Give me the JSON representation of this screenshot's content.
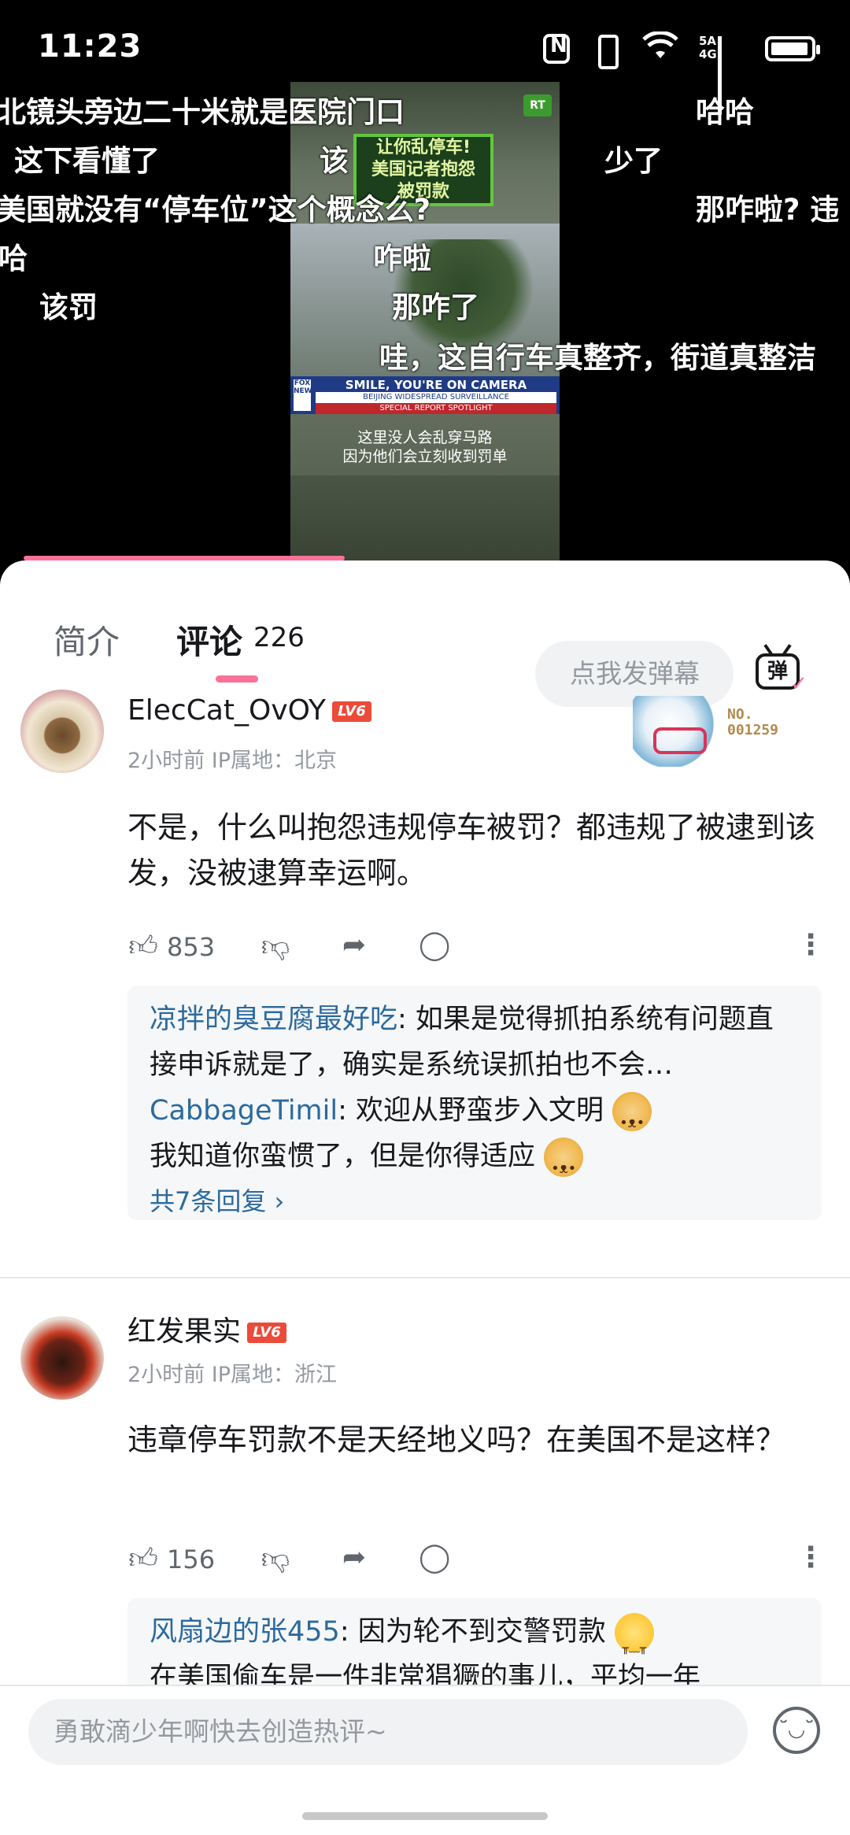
{
  "status_bar": {
    "time": "11:23",
    "network": "5A\n4G",
    "icons": [
      "nfc-icon",
      "vibrate-icon",
      "wifi-icon",
      "signal-icon",
      "battery-icon"
    ]
  },
  "video": {
    "overlay_title": [
      "让你乱停车!",
      "美国记者抱怨",
      "被罚款"
    ],
    "rt_logo": "RT",
    "banner_main": "SMILE, YOU'RE ON CAMERA",
    "banner_sub": "BEIJING WIDESPREAD SURVEILLANCE",
    "banner_tag": "SPECIAL REPORT SPOTLIGHT",
    "fox_logo": "FOX NEWS",
    "subtitle_lines": [
      "这里没人会乱穿马路",
      "因为他们会立刻收到罚单"
    ],
    "progress_fraction": 0.4
  },
  "danmaku": [
    "北镜头旁边二十米就是医院门口",
    "哈哈",
    "这下看懂了",
    "该",
    "少了",
    "美国就没有“停车位”这个概念么?",
    "那咋啦? 违",
    "哈",
    "咋啦",
    "该罚",
    "那咋了",
    "哇，这自行车真整齐，街道真整洁"
  ],
  "tabs": {
    "intro": "简介",
    "comments": "评论",
    "comment_count": "226",
    "danmaku_placeholder": "点我发弹幕",
    "danmaku_button": "弹"
  },
  "comments": [
    {
      "username": "ElecCat_OvOY",
      "level": "LV6",
      "meta": "2小时前 IP属地：北京",
      "text": "不是，什么叫抱怨违规停车被罚？都违规了被逮到该发，没被逮算幸运啊。",
      "likes": "853",
      "sticker_no": "NO.\n001259",
      "replies": [
        {
          "name": "凉拌的臭豆腐最好吃",
          "text": ": 如果是觉得抓拍系统有问题直接申诉就是了，确实是系统误抓拍也不会…"
        },
        {
          "name": "CabbageTimil",
          "text": ": 欢迎从野蛮步入文明",
          "text2": "我知道你蛮惯了，但是你得适应"
        }
      ],
      "reply_more": "共7条回复 ›"
    },
    {
      "username": "红发果实",
      "level": "LV6",
      "meta": "2小时前 IP属地：浙江",
      "text": "违章停车罚款不是天经地义吗？在美国不是这样？",
      "likes": "156",
      "replies": [
        {
          "name": "风扇边的张455",
          "text": ": 因为轮不到交警罚款",
          "text2": "在美国偷车是一件非常猖獗的事儿，平均一年"
        }
      ]
    }
  ],
  "bottom": {
    "comment_placeholder": "勇敢滴少年啊快去创造热评~"
  },
  "colors": {
    "accent_pink": "#fb7299",
    "reply_name_blue": "#2b6a9e",
    "level_red": "#ec4b3a"
  }
}
